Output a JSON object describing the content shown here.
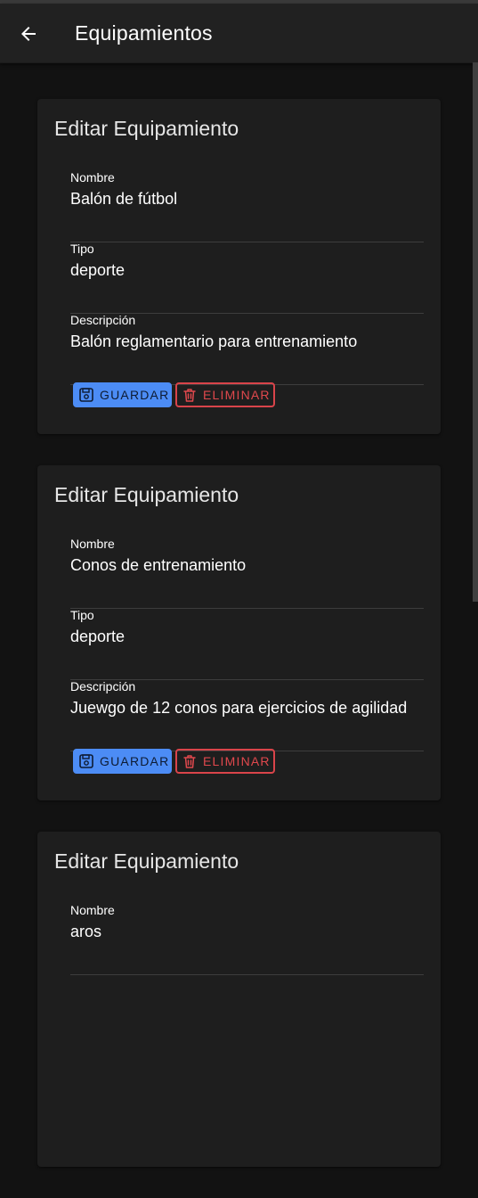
{
  "appbar": {
    "title": "Equipamientos"
  },
  "labels": {
    "name": "Nombre",
    "type": "Tipo",
    "description": "Descripción"
  },
  "cards": [
    {
      "title": "Editar Equipamiento",
      "name": "Balón de fútbol",
      "type": "deporte",
      "description": "Balón reglamentario para entrenamiento",
      "save_label": "GUARDAR",
      "delete_label": "ELIMINAR"
    },
    {
      "title": "Editar Equipamiento",
      "name": "Conos de entrenamiento",
      "type": "deporte",
      "description": "Juewgo de 12 conos para ejercicios de agilidad",
      "save_label": "GUARDAR",
      "delete_label": "ELIMINAR"
    },
    {
      "title": "Editar Equipamiento",
      "name": "aros"
    }
  ],
  "colors": {
    "primary": "#4c8cf5",
    "danger": "#e0484d",
    "background": "#121212",
    "card": "#1e1e1e"
  },
  "icons": {
    "back": "arrow-left-icon",
    "save": "floppy-disk-icon",
    "delete": "trash-icon"
  }
}
